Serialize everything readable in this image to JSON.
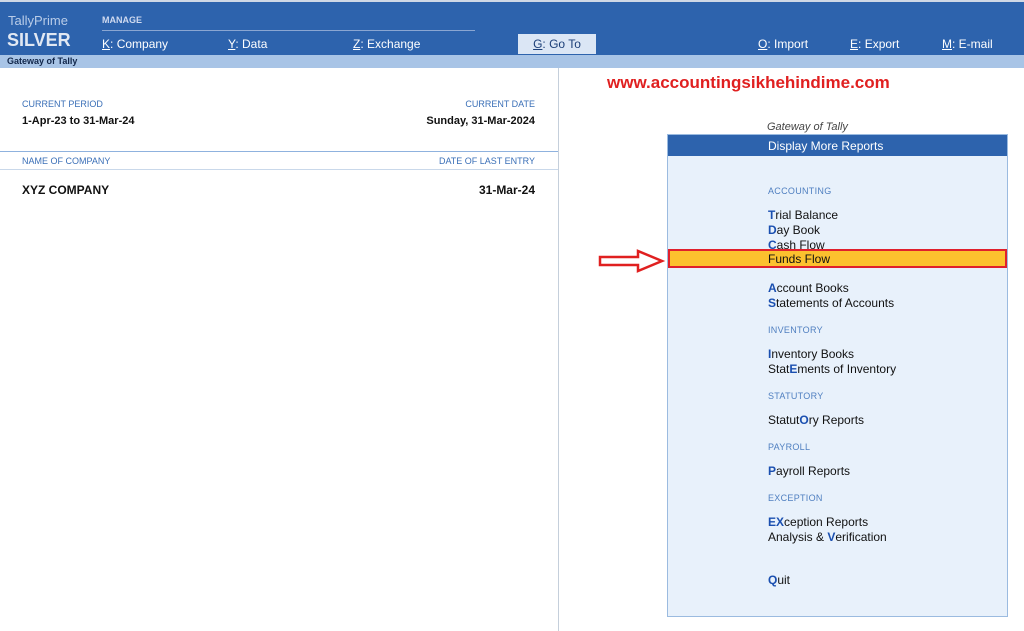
{
  "brand": {
    "product": "TallyPrime",
    "edition": "SILVER"
  },
  "topbar": {
    "manage_label": "MANAGE",
    "menus": [
      {
        "key": "K",
        "label": "Company"
      },
      {
        "key": "Y",
        "label": "Data"
      },
      {
        "key": "Z",
        "label": "Exchange"
      },
      {
        "key": "G",
        "label": "Go To"
      },
      {
        "key": "O",
        "label": "Import"
      },
      {
        "key": "E",
        "label": "Export"
      },
      {
        "key": "M",
        "label": "E-mail"
      }
    ]
  },
  "gateway_bar": "Gateway of Tally",
  "left": {
    "current_period_label": "CURRENT PERIOD",
    "current_period_value": "1-Apr-23 to 31-Mar-24",
    "current_date_label": "CURRENT DATE",
    "current_date_value": "Sunday, 31-Mar-2024",
    "company_header": "NAME OF COMPANY",
    "last_entry_header": "DATE OF LAST ENTRY",
    "company_name": "XYZ COMPANY",
    "last_entry_date": "31-Mar-24"
  },
  "watermark_url": "www.accountingsikhehindime.com",
  "panel": {
    "title": "Gateway of Tally",
    "header": "Display More Reports",
    "sections": {
      "accounting": "ACCOUNTING",
      "inventory": "INVENTORY",
      "statutory": "STATUTORY",
      "payroll": "PAYROLL",
      "exception": "EXCEPTION"
    },
    "items": {
      "trial_balance": {
        "hk": "T",
        "rest": "rial Balance"
      },
      "day_book": {
        "hk": "D",
        "rest": "ay Book"
      },
      "cash_flow": {
        "hk": "C",
        "rest": "ash Flow"
      },
      "funds_flow": "Funds Flow",
      "account_books": {
        "hk": "A",
        "rest": "ccount Books"
      },
      "statements": {
        "hk": "S",
        "rest": "tatements of Accounts"
      },
      "inventory_books": {
        "hk": "I",
        "rest": "nventory Books"
      },
      "stat_inv_pre": "Stat",
      "stat_inv_hk": "E",
      "stat_inv_post": "ments of Inventory",
      "statutory_pre": "Statut",
      "statutory_hk": "O",
      "statutory_post": "ry Reports",
      "payroll": {
        "hk": "P",
        "rest": "ayroll Reports"
      },
      "exception_pre": "E",
      "exception_hk": "X",
      "exception_post": "ception Reports",
      "analysis_pre": "Analysis & ",
      "analysis_hk": "V",
      "analysis_post": "erification",
      "quit": {
        "hk": "Q",
        "rest": "uit"
      }
    }
  }
}
